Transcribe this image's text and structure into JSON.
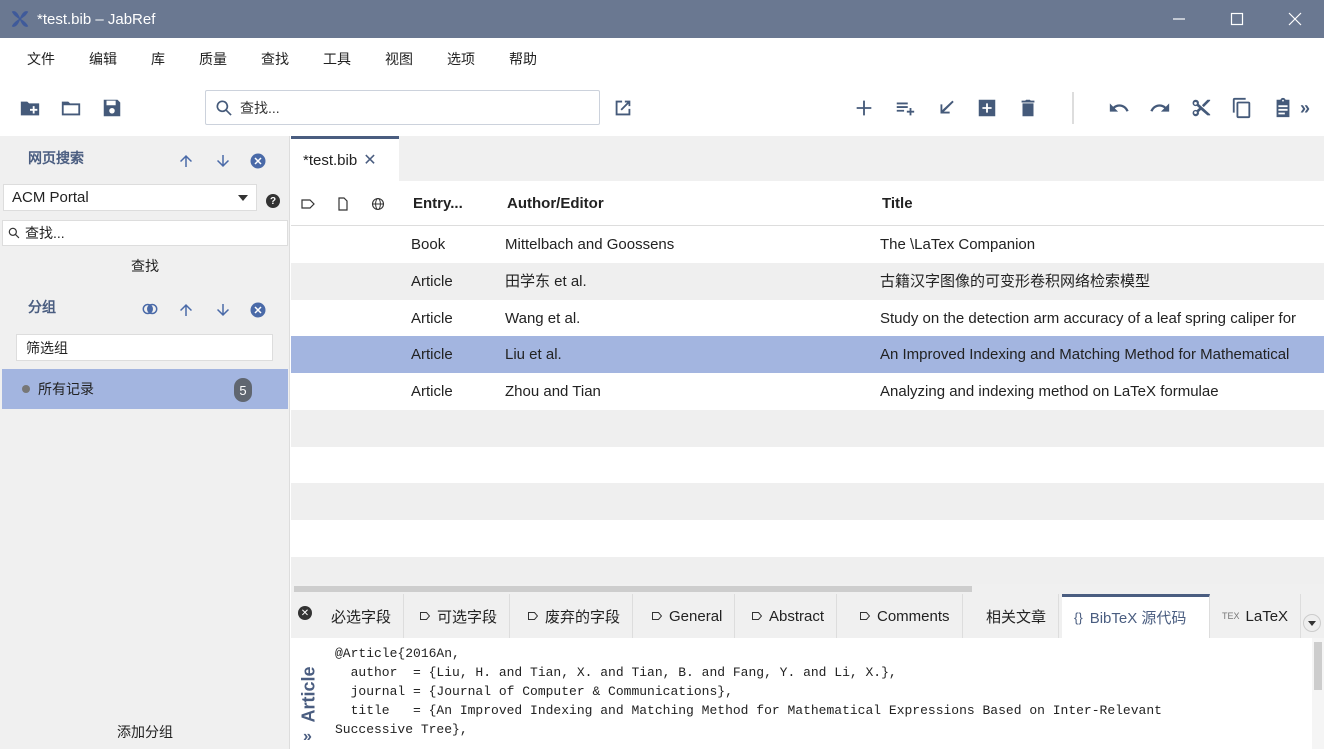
{
  "window": {
    "title": "*test.bib – JabRef"
  },
  "menu": [
    "文件",
    "编辑",
    "库",
    "质量",
    "查找",
    "工具",
    "视图",
    "选项",
    "帮助"
  ],
  "toolbar": {
    "search_placeholder": "查找..."
  },
  "web_search": {
    "title": "网页搜索",
    "fetcher": "ACM Portal",
    "query_placeholder": "查找...",
    "search_label": "查找"
  },
  "groups": {
    "title": "分组",
    "filter_placeholder": "筛选组",
    "items": [
      {
        "name": "所有记录",
        "count": "5"
      }
    ],
    "add_label": "添加分组"
  },
  "library_tab": {
    "label": "*test.bib",
    "close": "✕"
  },
  "table": {
    "columns": [
      "Entry...",
      "Author/Editor",
      "Title"
    ],
    "rows": [
      {
        "type": "Book",
        "author": "Mittelbach and Goossens",
        "title": "The \\LaTex Companion"
      },
      {
        "type": "Article",
        "author": "田学东 et al.",
        "title": "古籍汉字图像的可变形卷积网络检索模型"
      },
      {
        "type": "Article",
        "author": "Wang et al.",
        "title": "Study on the detection arm accuracy of a leaf spring caliper for"
      },
      {
        "type": "Article",
        "author": "Liu et al.",
        "title": "An Improved Indexing and Matching Method for Mathematical"
      },
      {
        "type": "Article",
        "author": "Zhou and Tian",
        "title": "Analyzing and indexing method on LaTeX formulae"
      }
    ],
    "selected_index": 3
  },
  "editor": {
    "tabs": [
      "必选字段",
      "可选字段",
      "废弃的字段",
      "General",
      "Abstract",
      "Comments",
      "相关文章",
      "BibTeX 源代码",
      "LaTeX"
    ],
    "active_tab": "BibTeX 源代码",
    "entry_type": "Article",
    "source_lines": [
      "@Article{2016An,",
      "  author  = {Liu, H. and Tian, X. and Tian, B. and Fang, Y. and Li, X.},",
      "  journal = {Journal of Computer & Communications},",
      "  title   = {An Improved Indexing and Matching Method for Mathematical Expressions Based on Inter-Relevant",
      "Successive Tree},"
    ]
  },
  "colors": {
    "titlebar": "#6a7891",
    "accent": "#4a5d80",
    "selection": "#a3b5e0",
    "icon": "#455a7a"
  }
}
